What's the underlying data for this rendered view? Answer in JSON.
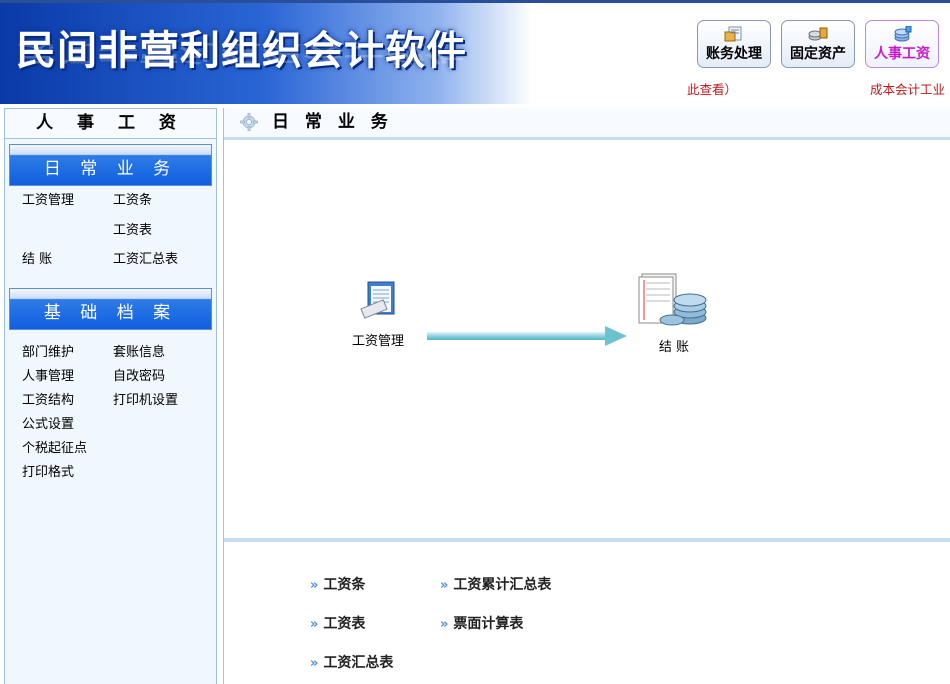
{
  "header": {
    "app_title": "民间非营利组织会计软件",
    "modules": [
      {
        "label": "账务处理",
        "icon": "ledger-icon"
      },
      {
        "label": "固定资产",
        "icon": "assets-icon"
      },
      {
        "label": "人事工资",
        "icon": "payroll-icon",
        "active": true
      }
    ],
    "notice_left": "此查看）",
    "notice_right": "成本会计工业",
    "colors": {
      "title_blue": "#0a3aa8",
      "active_module_text": "#c81cc8",
      "notice_red": "#c0181c"
    }
  },
  "sidebar": {
    "title": "人 事 工 资",
    "daily": {
      "heading": "日 常 业 务",
      "rows": [
        [
          "工资管理",
          "工资条"
        ],
        [
          "",
          "工资表"
        ],
        [
          "结  账",
          "工资汇总表"
        ]
      ]
    },
    "archive": {
      "heading": "基 础 档 案",
      "rows": [
        [
          "部门维护",
          "套账信息"
        ],
        [
          "人事管理",
          "自改密码"
        ],
        [
          "工资结构",
          "打印机设置"
        ],
        [
          "公式设置",
          ""
        ],
        [
          "个税起征点",
          ""
        ],
        [
          "打印格式",
          ""
        ]
      ]
    }
  },
  "main": {
    "title": "日 常 业 务",
    "flow": {
      "start_label": "工资管理",
      "end_label": "结  账"
    },
    "reports": {
      "col1": [
        "工资条",
        "工资表",
        "工资汇总表"
      ],
      "col2": [
        "工资累计汇总表",
        "票面计算表"
      ]
    }
  }
}
